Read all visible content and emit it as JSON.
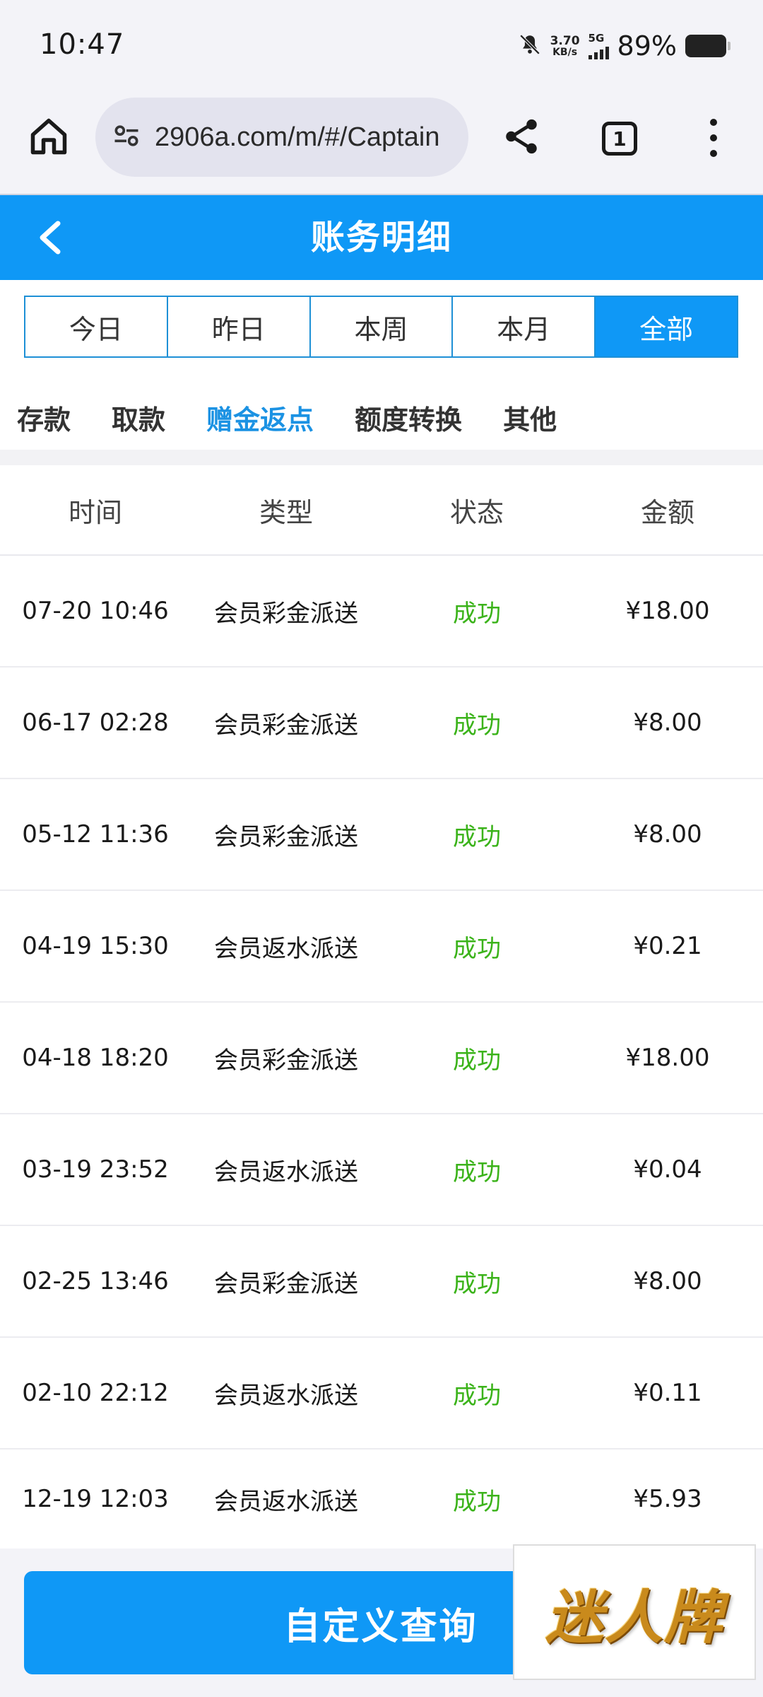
{
  "status_bar": {
    "time": "10:47",
    "net_speed_value": "3.70",
    "net_speed_unit": "KB/s",
    "network": "5G",
    "battery": "89%"
  },
  "browser": {
    "url": "2906a.com/m/#/Captain",
    "tab_count": "1"
  },
  "header": {
    "title": "账务明细"
  },
  "period_tabs": [
    {
      "label": "今日",
      "active": false
    },
    {
      "label": "昨日",
      "active": false
    },
    {
      "label": "本周",
      "active": false
    },
    {
      "label": "本月",
      "active": false
    },
    {
      "label": "全部",
      "active": true
    }
  ],
  "category_tabs": [
    {
      "label": "存款",
      "active": false
    },
    {
      "label": "取款",
      "active": false
    },
    {
      "label": "赠金返点",
      "active": true
    },
    {
      "label": "额度转换",
      "active": false
    },
    {
      "label": "其他",
      "active": false
    }
  ],
  "table": {
    "headers": [
      "时间",
      "类型",
      "状态",
      "金额"
    ],
    "rows": [
      {
        "time": "07-20 10:46",
        "type": "会员彩金派送",
        "status": "成功",
        "amount": "¥18.00"
      },
      {
        "time": "06-17 02:28",
        "type": "会员彩金派送",
        "status": "成功",
        "amount": "¥8.00"
      },
      {
        "time": "05-12 11:36",
        "type": "会员彩金派送",
        "status": "成功",
        "amount": "¥8.00"
      },
      {
        "time": "04-19 15:30",
        "type": "会员返水派送",
        "status": "成功",
        "amount": "¥0.21"
      },
      {
        "time": "04-18 18:20",
        "type": "会员彩金派送",
        "status": "成功",
        "amount": "¥18.00"
      },
      {
        "time": "03-19 23:52",
        "type": "会员返水派送",
        "status": "成功",
        "amount": "¥0.04"
      },
      {
        "time": "02-25 13:46",
        "type": "会员彩金派送",
        "status": "成功",
        "amount": "¥8.00"
      },
      {
        "time": "02-10 22:12",
        "type": "会员返水派送",
        "status": "成功",
        "amount": "¥0.11"
      },
      {
        "time": "12-19 12:03",
        "type": "会员返水派送",
        "status": "成功",
        "amount": "¥5.93"
      }
    ]
  },
  "footer": {
    "query_button": "自定义查询",
    "watermark": "迷人牌"
  },
  "colors": {
    "primary": "#0f98f6",
    "active_category": "#1b92e3",
    "success": "#3bb31a",
    "border": "#1e90d6"
  }
}
